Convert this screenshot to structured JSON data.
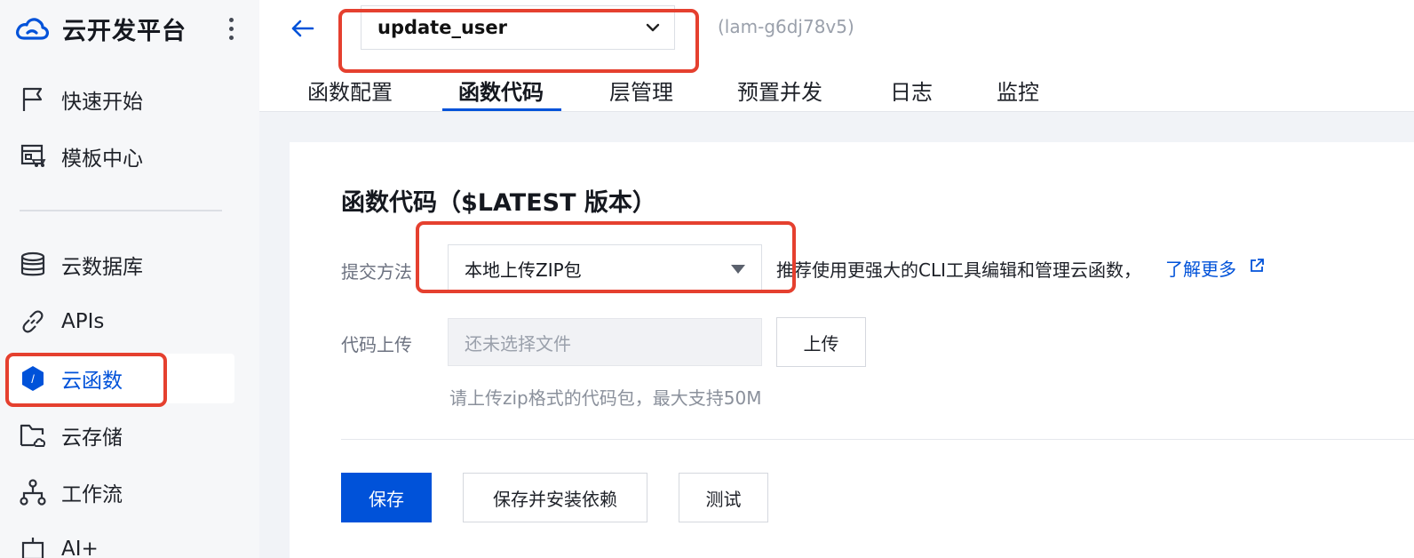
{
  "brand": {
    "title": "云开发平台",
    "logo_icon": "cloud-icon",
    "more_icon": "more-vertical-icon"
  },
  "sidebar": {
    "items": [
      {
        "label": "快速开始",
        "icon": "flag-icon"
      },
      {
        "label": "模板中心",
        "icon": "template-icon"
      },
      {
        "label": "云数据库",
        "icon": "database-icon"
      },
      {
        "label": "APIs",
        "icon": "link-icon"
      },
      {
        "label": "云函数",
        "icon": "function-icon",
        "active": true
      },
      {
        "label": "云存储",
        "icon": "folder-cloud-icon"
      },
      {
        "label": "工作流",
        "icon": "workflow-icon"
      },
      {
        "label": "AI+",
        "icon": "ai-icon"
      }
    ]
  },
  "header": {
    "back_icon": "arrow-left-icon",
    "function_name": "update_user",
    "function_id": "(lam-g6dj78v5)",
    "tabs": [
      {
        "label": "函数配置"
      },
      {
        "label": "函数代码",
        "active": true
      },
      {
        "label": "层管理"
      },
      {
        "label": "预置并发"
      },
      {
        "label": "日志"
      },
      {
        "label": "监控"
      }
    ]
  },
  "main": {
    "section_title": "函数代码（$LATEST 版本）",
    "submit_method_label": "提交方法",
    "submit_method_value": "本地上传ZIP包",
    "submit_hint": "推荐使用更强大的CLI工具编辑和管理云函数，",
    "learn_more": "了解更多",
    "code_upload_label": "代码上传",
    "file_placeholder": "还未选择文件",
    "upload_button": "上传",
    "upload_hint": "请上传zip格式的代码包，最大支持50M",
    "save_button": "保存",
    "save_install_button": "保存并安装依赖",
    "test_button": "测试"
  },
  "colors": {
    "accent": "#0052d9",
    "annotation": "#e5402f"
  }
}
